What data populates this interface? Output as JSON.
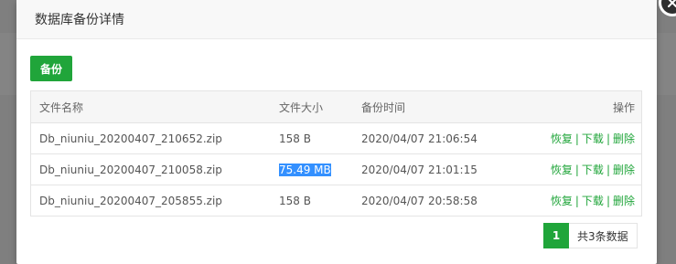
{
  "dialog": {
    "title": "数据库备份详情",
    "backup_button": "备份"
  },
  "table": {
    "headers": {
      "name": "文件名称",
      "size": "文件大小",
      "time": "备份时间",
      "ops": "操作"
    },
    "rows": [
      {
        "name": "Db_niuniu_20200407_210652.zip",
        "size": "158 B",
        "time": "2020/04/07 21:06:54",
        "restore": "恢复",
        "download": "下载",
        "delete": "删除",
        "separator": "|"
      },
      {
        "name": "Db_niuniu_20200407_210058.zip",
        "size": "75.49 MB",
        "time": "2020/04/07 21:01:15",
        "restore": "恢复",
        "download": "下载",
        "delete": "删除",
        "separator": "|"
      },
      {
        "name": "Db_niuniu_20200407_205855.zip",
        "size": "158 B",
        "time": "2020/04/07 20:58:58",
        "restore": "恢复",
        "download": "下载",
        "delete": "删除",
        "separator": "|"
      }
    ]
  },
  "pagination": {
    "current_page": "1",
    "total_text": "共3条数据"
  },
  "colors": {
    "accent": "#20a53a",
    "selection": "#3390ff"
  },
  "icons": {
    "close": "close-icon"
  }
}
